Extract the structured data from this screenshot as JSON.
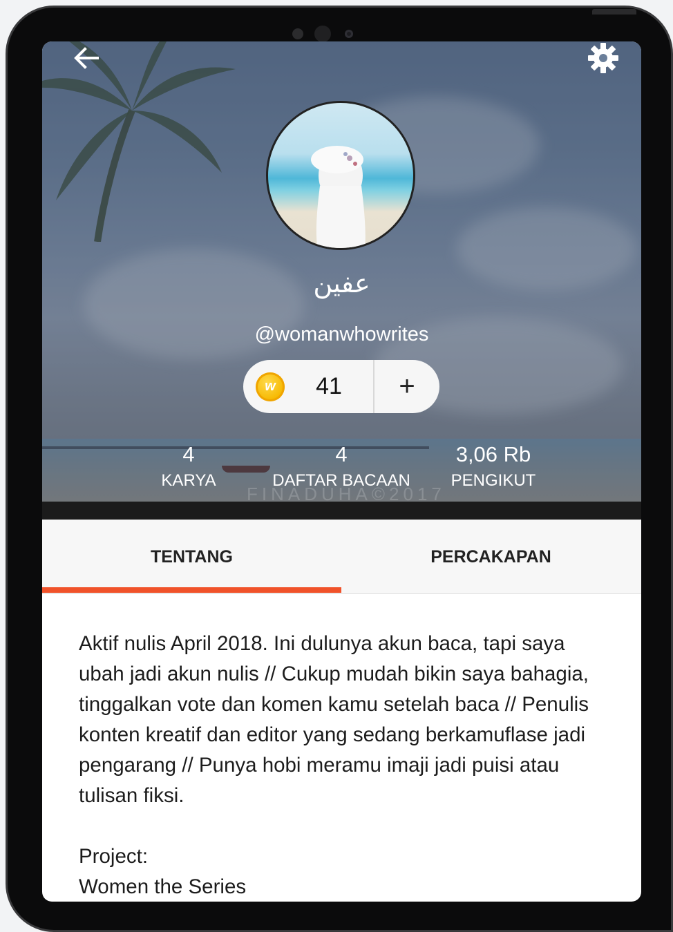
{
  "profile": {
    "display_name": "عفين",
    "username": "@womanwhowrites",
    "coins": "41",
    "coin_add_label": "+",
    "coin_icon_letter": "w"
  },
  "stats": [
    {
      "value": "4",
      "label": "KARYA"
    },
    {
      "value": "4",
      "label": "DAFTAR BACAAN"
    },
    {
      "value": "3,06 Rb",
      "label": "PENGIKUT"
    }
  ],
  "watermark": "FINADUHA©2017",
  "tabs": {
    "active": "TENTANG",
    "items": [
      "TENTANG",
      "PERCAKAPAN"
    ]
  },
  "about": {
    "bio": "Aktif nulis April 2018. Ini dulunya akun baca, tapi saya ubah jadi akun nulis // Cukup mudah bikin saya bahagia, tinggalkan vote dan komen kamu setelah baca // Penulis konten kreatif dan editor yang sedang berkamuflase jadi pengarang // Punya hobi meramu imaji jadi puisi atau tulisan fiksi.",
    "project_label": "Project:",
    "project_name": "Women the Series"
  },
  "icons": {
    "back": "arrow-left-icon",
    "settings": "gear-icon",
    "coin": "coin-icon"
  },
  "colors": {
    "accent": "#f0522a",
    "coin": "#f6b800"
  }
}
